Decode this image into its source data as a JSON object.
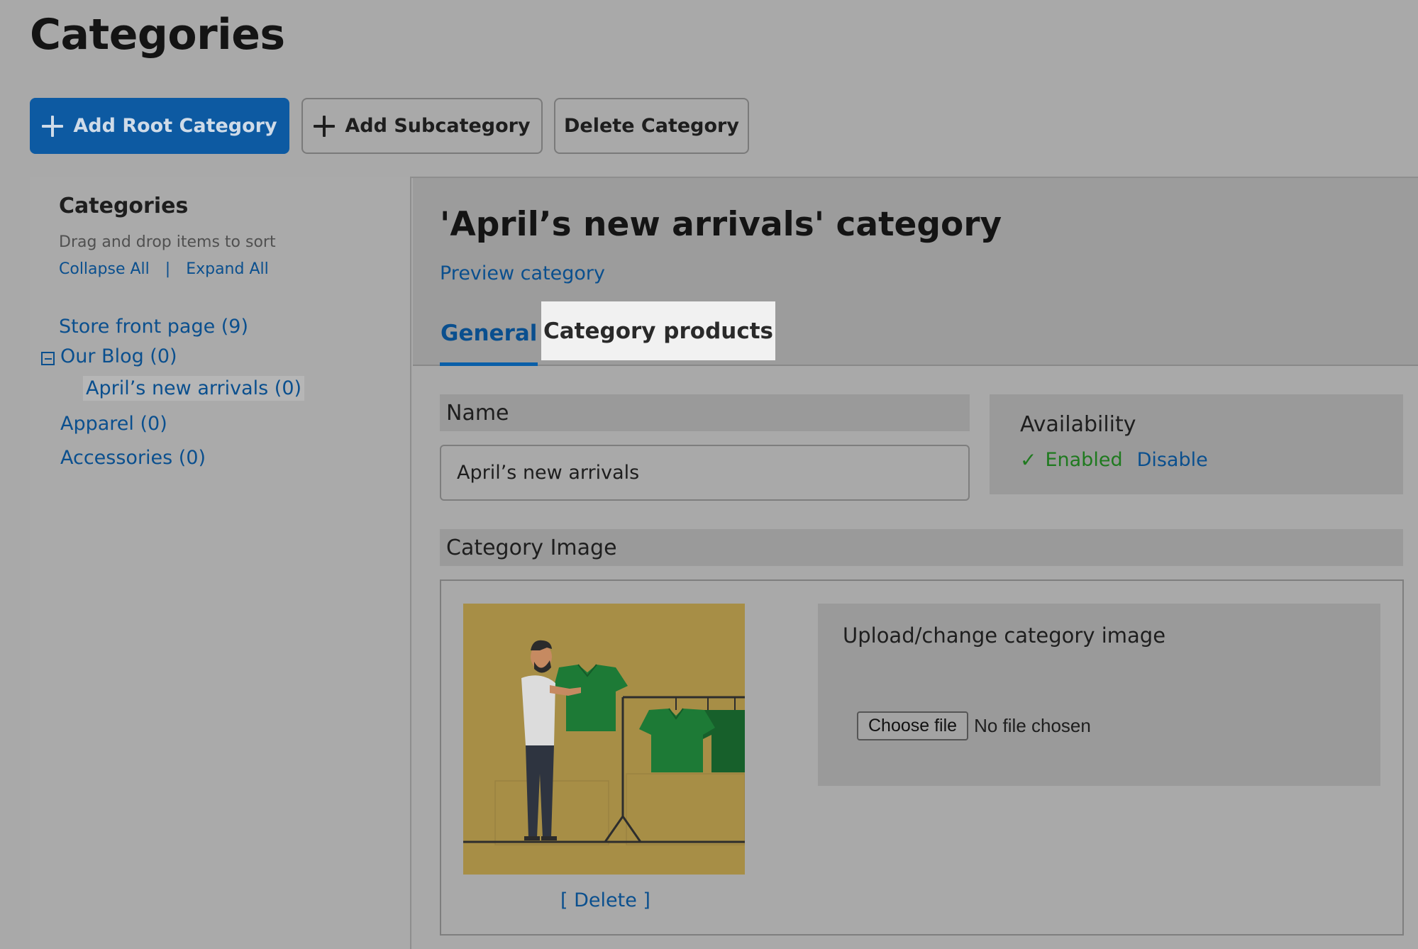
{
  "page": {
    "title": "Categories"
  },
  "toolbar": {
    "add_root_label": "Add Root Category",
    "add_sub_label": "Add Subcategory",
    "delete_label": "Delete Category"
  },
  "sidebar": {
    "title": "Categories",
    "hint": "Drag and drop items to sort",
    "collapse_all": "Collapse All",
    "separator": "|",
    "expand_all": "Expand All",
    "items": [
      {
        "label": "Store front page (9)",
        "level": 0
      },
      {
        "label": "Our Blog (0)",
        "level": 0,
        "expanded": true
      },
      {
        "label": "April’s new arrivals (0)",
        "level": 1,
        "selected": true
      },
      {
        "label": "Apparel (0)",
        "level": 0
      },
      {
        "label": "Accessories (0)",
        "level": 0
      }
    ]
  },
  "main": {
    "heading": "'April’s new arrivals' category",
    "preview_link": "Preview category",
    "tabs": [
      {
        "label": "General",
        "active": true
      },
      {
        "label": "Category products",
        "highlighted": true
      }
    ],
    "name_label": "Name",
    "name_value": "April’s new arrivals",
    "availability": {
      "title": "Availability",
      "status": "Enabled",
      "action": "Disable"
    },
    "image": {
      "label": "Category Image",
      "delete_link": "[ Delete ]",
      "upload_title": "Upload/change category image",
      "choose_file": "Choose file",
      "file_status": "No file chosen"
    }
  },
  "colors": {
    "primary": "#0d5aa2",
    "link": "#0a4f8e",
    "enabled": "#1f7a1f",
    "thumb_bg": "#a78e46",
    "shirt": "#1d7a36"
  }
}
